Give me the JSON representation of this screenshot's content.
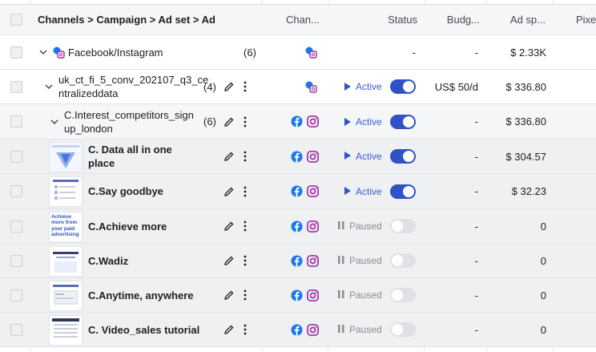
{
  "header": {
    "name_col": "Channels > Campaign > Ad set > Ad",
    "channels_col": "Chan...",
    "status_col": "Status",
    "budget_col": "Budg...",
    "spend_col": "Ad sp...",
    "pixel_col": "Pixe"
  },
  "campaign_group": {
    "name": "Facebook/Instagram",
    "count": "(6)",
    "status": "-",
    "budget": "-",
    "spend": "$ 2.33K"
  },
  "campaign": {
    "name_line1": "uk_ct_fi_5_conv_202107_q3_ce",
    "name_line2": "ntralizeddata",
    "count": "(4)",
    "status": "Active",
    "budget": "US$ 50/d",
    "spend": "$ 336.80"
  },
  "adset": {
    "name_line1": "C.Interest_competitors_sign",
    "name_line2": "up_london",
    "count": "(6)",
    "status": "Active",
    "budget": "-",
    "spend": "$ 336.80"
  },
  "ads": [
    {
      "name_line1": "C. Data all in one",
      "name_line2": "place",
      "status": "Active",
      "budget": "-",
      "spend": "$ 304.57"
    },
    {
      "name_line1": "C.Say goodbye",
      "name_line2": "",
      "status": "Active",
      "budget": "-",
      "spend": "$ 32.23"
    },
    {
      "name_line1": "C.Achieve more",
      "name_line2": "",
      "status": "Paused",
      "budget": "-",
      "spend": "0"
    },
    {
      "name_line1": "C.Wadiz",
      "name_line2": "",
      "status": "Paused",
      "budget": "-",
      "spend": "0"
    },
    {
      "name_line1": "C.Anytime, anywhere",
      "name_line2": "",
      "status": "Paused",
      "budget": "-",
      "spend": "0"
    },
    {
      "name_line1": "C. Video_sales tutorial",
      "name_line2": "",
      "status": "Paused",
      "budget": "-",
      "spend": "0"
    }
  ],
  "thumb_texts": {
    "ad3": "Achieve more from your paid advertising"
  },
  "colors": {
    "facebook": "#1877f2",
    "instagram": "#a12fa6",
    "active": "#3b5bdb",
    "toggle_on": "#2f52c7"
  }
}
